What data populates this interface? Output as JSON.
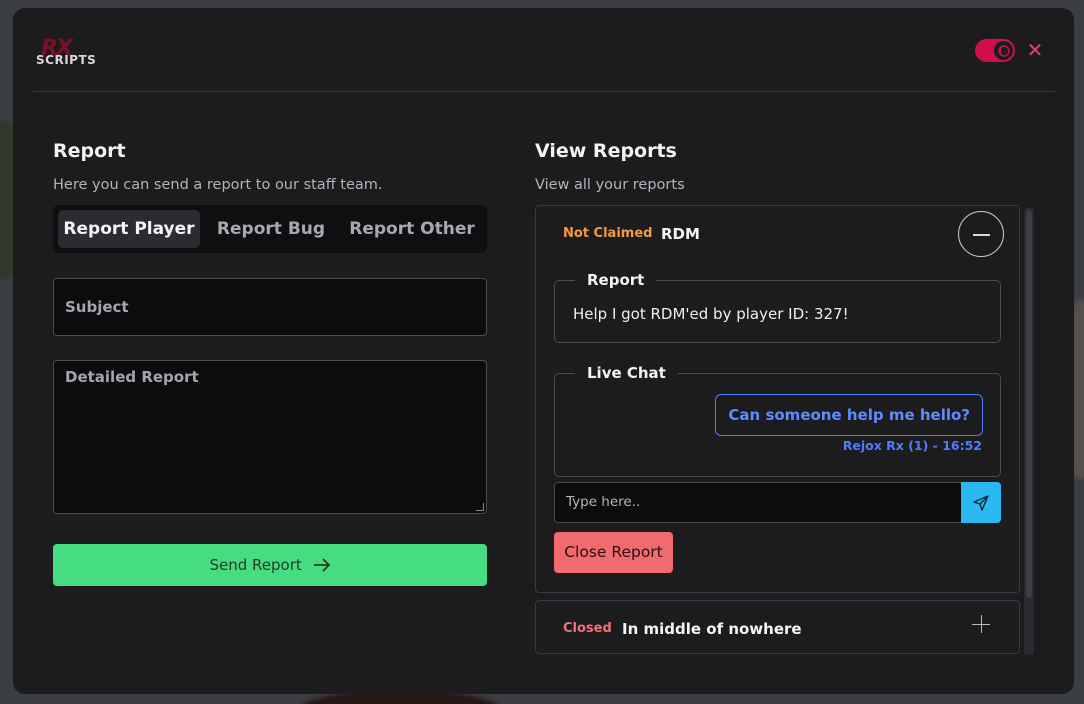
{
  "header": {
    "logo_mark": "RX",
    "logo_text": "SCRIPTS"
  },
  "report": {
    "heading": "Report",
    "subtitle": "Here you can send a report to our staff team.",
    "tabs": [
      {
        "label": "Report Player",
        "active": true
      },
      {
        "label": "Report Bug",
        "active": false
      },
      {
        "label": "Report Other",
        "active": false
      }
    ],
    "subject_placeholder": "Subject",
    "detailed_placeholder": "Detailed Report",
    "send_label": "Send Report"
  },
  "view": {
    "heading": "View Reports",
    "subtitle": "View all your reports",
    "reports": [
      {
        "status": "Not Claimed",
        "status_color": "#f59a3c",
        "title": "RDM",
        "report_legend": "Report",
        "report_text": "Help I got RDM'ed by player ID: 327!",
        "chat_legend": "Live Chat",
        "messages": [
          {
            "text": "Can someone help me hello?",
            "meta": "Rejox Rx (1) - 16:52"
          }
        ],
        "chat_placeholder": "Type here..",
        "close_label": "Close Report"
      },
      {
        "status": "Closed",
        "status_color": "#f07377",
        "title": "In middle of nowhere"
      }
    ]
  },
  "colors": {
    "accent_green": "#47dc81",
    "accent_blue": "#4f7dff",
    "accent_red": "#f06a6e",
    "toggle": "#cf1048"
  }
}
